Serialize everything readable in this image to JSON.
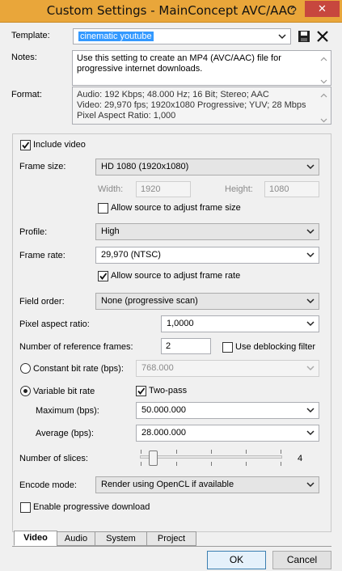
{
  "window": {
    "title": "Custom Settings - MainConcept AVC/AAC",
    "help_glyph": "?",
    "close_glyph": "✕"
  },
  "template": {
    "label": "Template:",
    "value": "cinematic youtube"
  },
  "notes": {
    "label": "Notes:",
    "lines": [
      "Use this setting to create an MP4 (AVC/AAC) file for",
      "progressive internet downloads."
    ]
  },
  "format": {
    "label": "Format:",
    "lines": [
      "Audio: 192 Kbps; 48.000 Hz; 16 Bit; Stereo; AAC",
      "Video: 29,970 fps; 1920x1080 Progressive; YUV; 28 Mbps",
      "Pixel Aspect Ratio: 1,000"
    ]
  },
  "video": {
    "include_video": {
      "label": "Include video",
      "checked": true
    },
    "frame_size": {
      "label": "Frame size:",
      "value": "HD 1080 (1920x1080)"
    },
    "width": {
      "label": "Width:",
      "value": "1920"
    },
    "height": {
      "label": "Height:",
      "value": "1080"
    },
    "allow_frame_size": {
      "label": "Allow source to adjust frame size",
      "checked": false
    },
    "profile": {
      "label": "Profile:",
      "value": "High"
    },
    "frame_rate": {
      "label": "Frame rate:",
      "value": "29,970 (NTSC)"
    },
    "allow_frame_rate": {
      "label": "Allow source to adjust frame rate",
      "checked": true
    },
    "field_order": {
      "label": "Field order:",
      "value": "None (progressive scan)"
    },
    "pixel_aspect": {
      "label": "Pixel aspect ratio:",
      "value": "1,0000"
    },
    "ref_frames": {
      "label": "Number of reference frames:",
      "value": "2"
    },
    "deblocking": {
      "label": "Use deblocking filter",
      "checked": false
    },
    "cbr": {
      "label": "Constant bit rate (bps):",
      "value": "768.000",
      "selected": false
    },
    "vbr": {
      "label": "Variable bit rate",
      "selected": true
    },
    "two_pass": {
      "label": "Two-pass",
      "checked": true
    },
    "maximum": {
      "label": "Maximum (bps):",
      "value": "50.000.000"
    },
    "average": {
      "label": "Average (bps):",
      "value": "28.000.000"
    },
    "slices": {
      "label": "Number of slices:",
      "value": "4"
    },
    "encode_mode": {
      "label": "Encode mode:",
      "value": "Render using OpenCL if available"
    },
    "progressive_download": {
      "label": "Enable progressive download",
      "checked": false
    }
  },
  "tabs": [
    {
      "label": "Video",
      "active": true
    },
    {
      "label": "Audio",
      "active": false
    },
    {
      "label": "System",
      "active": false
    },
    {
      "label": "Project",
      "active": false
    }
  ],
  "buttons": {
    "ok": "OK",
    "cancel": "Cancel"
  }
}
